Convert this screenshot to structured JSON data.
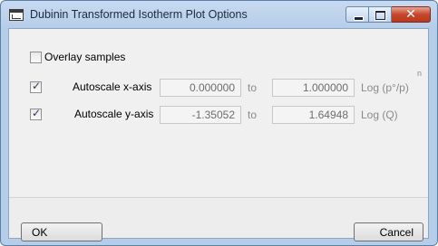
{
  "window": {
    "title": "Dubinin Transformed Isotherm Plot Options",
    "icon": "app-window-icon"
  },
  "caption_buttons": {
    "minimize_icon": "minimize-icon",
    "maximize_icon": "maximize-icon",
    "close_glyph": "✕"
  },
  "options": {
    "overlay": {
      "label": "Overlay samples",
      "checked": false
    },
    "x_axis": {
      "label": "Autoscale x-axis",
      "checked": true,
      "from": "0.000000",
      "to_label": "to",
      "to": "1.000000",
      "unit": "Log (p°/p)",
      "superscript": "n"
    },
    "y_axis": {
      "label": "Autoscale y-axis",
      "checked": true,
      "from": "-1.35052",
      "to_label": "to",
      "to": "1.64948",
      "unit": "Log (Q)"
    }
  },
  "buttons": {
    "ok": "OK",
    "cancel": "Cancel"
  }
}
